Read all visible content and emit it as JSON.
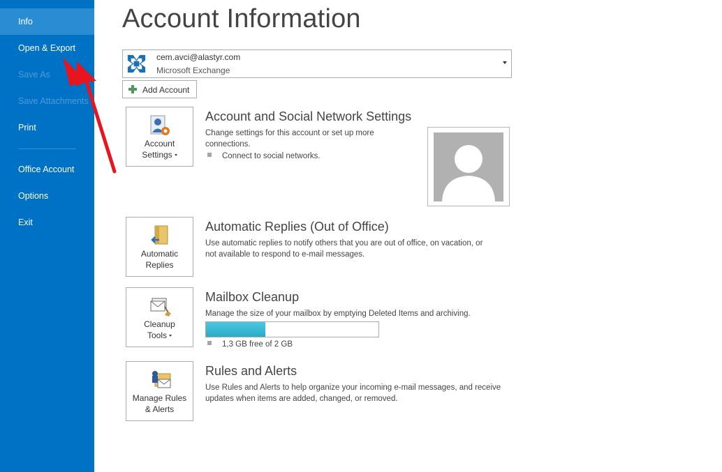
{
  "sidebar": {
    "items": [
      {
        "label": "Info",
        "state": "active"
      },
      {
        "label": "Open & Export",
        "state": "normal"
      },
      {
        "label": "Save As",
        "state": "disabled"
      },
      {
        "label": "Save Attachments",
        "state": "disabled"
      },
      {
        "label": "Print",
        "state": "normal"
      },
      {
        "label": "Office Account",
        "state": "normal"
      },
      {
        "label": "Options",
        "state": "normal"
      },
      {
        "label": "Exit",
        "state": "normal"
      }
    ]
  },
  "main": {
    "title": "Account Information",
    "account": {
      "email": "cem.avci@alastyr.com",
      "type": "Microsoft Exchange"
    },
    "add_account_label": "Add Account",
    "sections": {
      "account_settings": {
        "tile_line1": "Account",
        "tile_line2": "Settings",
        "title": "Account and Social Network Settings",
        "desc": "Change settings for this account or set up more connections.",
        "bullet": "Connect to social networks."
      },
      "auto_replies": {
        "tile_line1": "Automatic",
        "tile_line2": "Replies",
        "title": "Automatic Replies (Out of Office)",
        "desc_line1": "Use automatic replies to notify others that you are out of office, on vacation, or",
        "desc_line2": "not available to respond to e-mail messages."
      },
      "mailbox_cleanup": {
        "tile_line1": "Cleanup",
        "tile_line2": "Tools",
        "title": "Mailbox Cleanup",
        "desc": "Manage the size of your mailbox by emptying Deleted Items and archiving.",
        "usage_fraction": 0.345,
        "free_text": "1,3 GB free of 2 GB"
      },
      "rules_alerts": {
        "tile_line1": "Manage Rules",
        "tile_line2": "& Alerts",
        "title": "Rules and Alerts",
        "desc_line1": "Use Rules and Alerts to help organize your incoming e-mail messages, and receive",
        "desc_line2": "updates when items are added, changed, or removed."
      }
    }
  },
  "colors": {
    "sidebar_bg": "#0072C6",
    "sidebar_active": "#2A8DD4",
    "progress_fill": "#2BAAC8",
    "annotation_arrow": "#E8141E"
  },
  "icons": {
    "exchange": "exchange-logo-icon",
    "add": "plus-icon",
    "account_settings": "account-settings-icon",
    "auto_replies": "automatic-replies-icon",
    "cleanup": "cleanup-tools-icon",
    "rules": "manage-rules-icon",
    "profile": "profile-placeholder-icon",
    "annotation": "red-arrow-annotation"
  }
}
